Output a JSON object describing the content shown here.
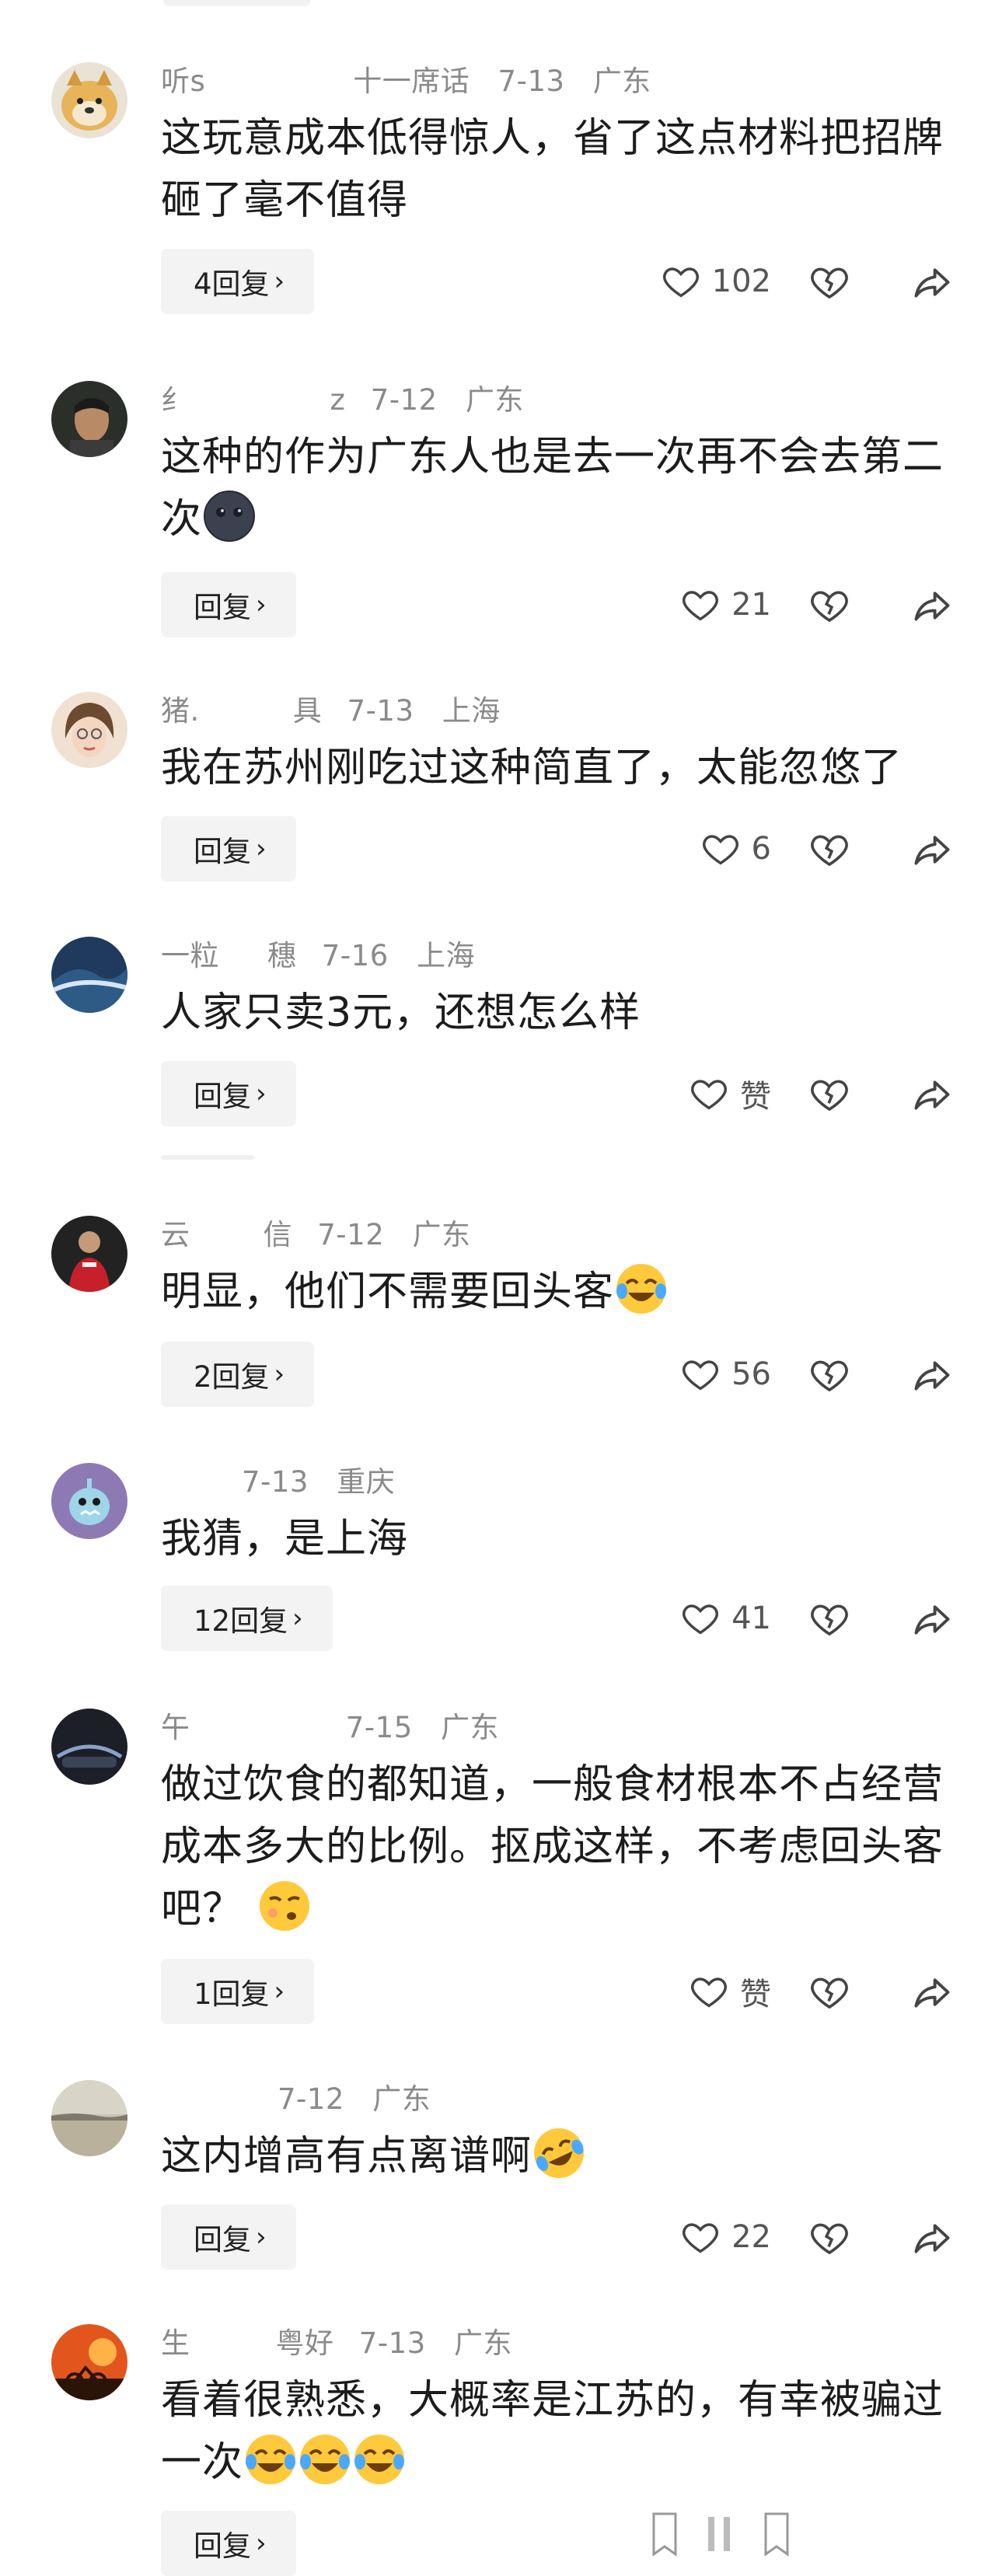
{
  "comments": [
    {
      "author": "听s",
      "author_tail": "十一席话",
      "date": "7-13",
      "location": "广东",
      "text": "这玩意成本低得惊人，省了这点材料把招牌砸了毫不值得",
      "reply": "4回复",
      "likes": "102"
    },
    {
      "author": "纟",
      "author_tail": "z",
      "date": "7-12",
      "location": "广东",
      "text": "这种的作为广东人也是去一次再不会去第二次",
      "reply": "回复",
      "likes": "21"
    },
    {
      "author": "猪.",
      "author_tail": "具",
      "date": "7-13",
      "location": "上海",
      "text": "我在苏州刚吃过这种简直了，太能忽悠了",
      "reply": "回复",
      "likes": "6"
    },
    {
      "author": "一粒",
      "author_tail": "穗",
      "date": "7-16",
      "location": "上海",
      "text": "人家只卖3元，还想怎么样",
      "reply": "回复",
      "likes": "赞"
    },
    {
      "author": "云",
      "author_tail": "信",
      "date": "7-12",
      "location": "广东",
      "text": "明显，他们不需要回头客",
      "reply": "2回复",
      "likes": "56"
    },
    {
      "author": "",
      "author_tail": "",
      "date": "7-13",
      "location": "重庆",
      "text": "我猜，是上海",
      "reply": "12回复",
      "likes": "41"
    },
    {
      "author": "午",
      "author_tail": "",
      "date": "7-15",
      "location": "广东",
      "text": "做过饮食的都知道，一般食材根本不占经营成本多大的比例。抠成这样，不考虑回头客吧？",
      "reply": "1回复",
      "likes": "赞"
    },
    {
      "author": "",
      "author_tail": "",
      "date": "7-12",
      "location": "广东",
      "text": "这内增高有点离谱啊",
      "reply": "回复",
      "likes": "22"
    },
    {
      "author": "生",
      "author_tail": "粤好",
      "date": "7-13",
      "location": "广东",
      "text": "看着很熟悉，大概率是江苏的，有幸被骗过一次",
      "reply": "回复",
      "likes": ""
    }
  ],
  "colors": {
    "meta": "#8a8a8a",
    "reply_bg": "#f3f3f3",
    "text": "#1c1c1c"
  },
  "icons": [
    "heart-icon",
    "broken-heart-icon",
    "share-icon",
    "chevron-right-icon"
  ]
}
